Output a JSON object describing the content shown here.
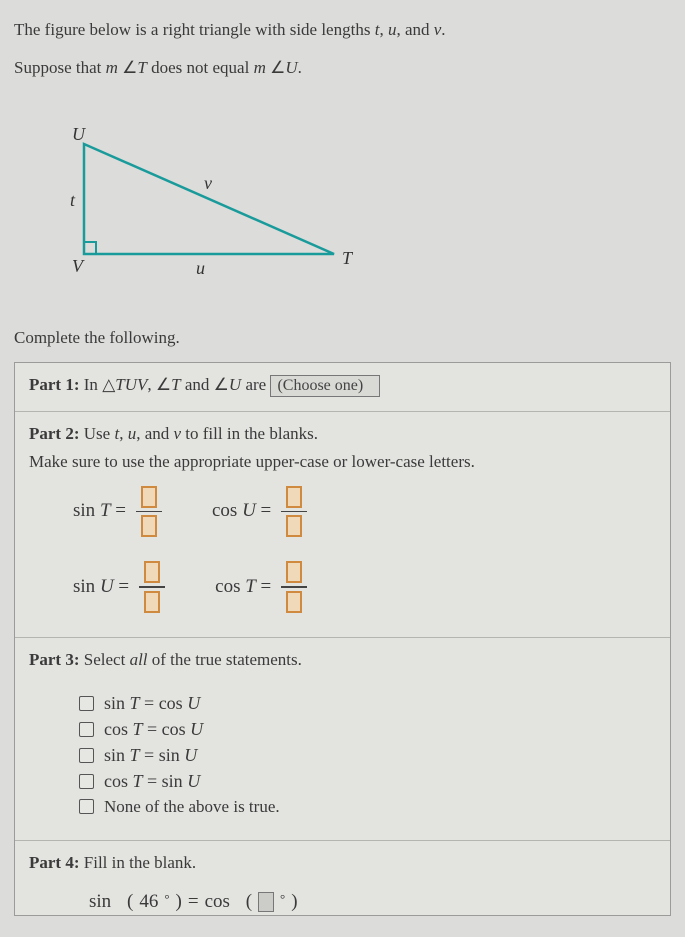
{
  "intro": {
    "line1_a": "The figure below is a right triangle with side lengths ",
    "line1_t": "t",
    "line1_c1": ", ",
    "line1_u": "u",
    "line1_c2": ", and ",
    "line1_v": "v",
    "line1_end": ".",
    "line2_a": "Suppose that ",
    "line2_m1": "m",
    "line2_ang": "∠",
    "line2_T": "T",
    "line2_mid": " does not equal ",
    "line2_m2": "m",
    "line2_U": "U",
    "line2_end": "."
  },
  "figure": {
    "U": "U",
    "V": "V",
    "T": "T",
    "t": "t",
    "u": "u",
    "v": "v"
  },
  "complete": "Complete the following.",
  "part1": {
    "label": "Part 1:",
    "text_a": " In ",
    "tri": "△",
    "TUV": "TUV",
    "c1": ", ",
    "ang1": "∠",
    "T": "T",
    "and": " and ",
    "ang2": "∠",
    "U": "U",
    "are": " are ",
    "dropdown": "(Choose one)"
  },
  "part2": {
    "label": "Part 2:",
    "line1_a": " Use ",
    "t": "t",
    "c1": ", ",
    "u": "u",
    "c2": ", and ",
    "v": "v",
    "line1_b": " to fill in the blanks.",
    "line2": "Make sure to use the appropriate upper-case or lower-case letters.",
    "eq1": "sin",
    "eq1v": "T",
    "eq1eq": " =",
    "eq2": "cos",
    "eq2v": "U",
    "eq2eq": " =",
    "eq3": "sin",
    "eq3v": "U",
    "eq3eq": " =",
    "eq4": "cos",
    "eq4v": "T",
    "eq4eq": " ="
  },
  "part3": {
    "label": "Part 3:",
    "text": " Select ",
    "all": "all",
    "text2": " of the true statements.",
    "opts": [
      {
        "f": "sin",
        "a": "T",
        "eq": " = ",
        "g": "cos",
        "b": "U"
      },
      {
        "f": "cos",
        "a": "T",
        "eq": " = ",
        "g": "cos",
        "b": "U"
      },
      {
        "f": "sin",
        "a": "T",
        "eq": " = ",
        "g": "sin",
        "b": "U"
      },
      {
        "f": "cos",
        "a": "T",
        "eq": " = ",
        "g": "sin",
        "b": "U"
      }
    ],
    "none": "None of the above is true."
  },
  "part4": {
    "label": "Part 4:",
    "text": " Fill in the blank.",
    "sin": "sin",
    "lp": "(",
    "val": "46",
    "deg": "°",
    "rp": ")",
    "eq": "  =  ",
    "cos": "cos",
    "lp2": "(",
    "deg2": "°",
    "rp2": ")"
  }
}
